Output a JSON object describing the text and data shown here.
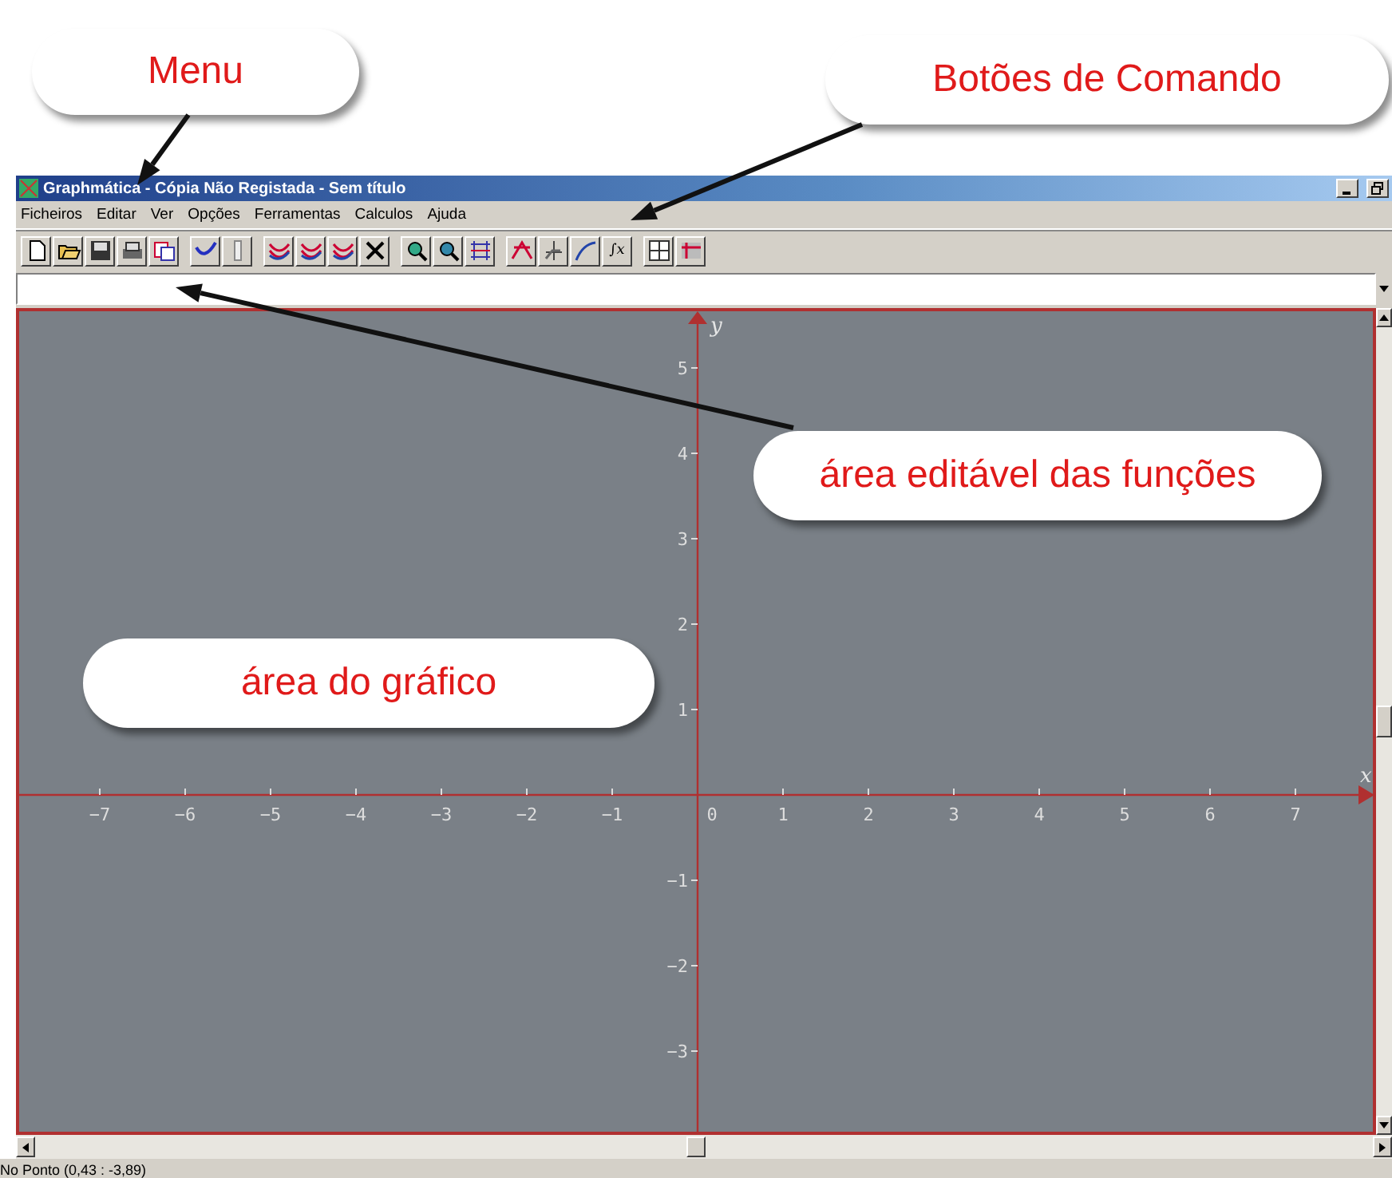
{
  "callouts": [
    {
      "text": "Menu"
    },
    {
      "text": "Botões de Comando"
    },
    {
      "text": "área editável das funções"
    },
    {
      "text": "área do gráfico"
    }
  ],
  "window": {
    "title": "Graphmática - Cópia Não Registada - Sem título"
  },
  "menu": [
    "Ficheiros",
    "Editar",
    "Ver",
    "Opções",
    "Ferramentas",
    "Calculos",
    "Ajuda"
  ],
  "toolbar": [
    [
      {
        "kind": "new"
      },
      {
        "kind": "open"
      },
      {
        "kind": "save"
      },
      {
        "kind": "print"
      },
      {
        "kind": "copy"
      }
    ],
    [
      {
        "kind": "pen"
      },
      {
        "kind": "ruler"
      }
    ],
    [
      {
        "kind": "curves"
      },
      {
        "kind": "curves"
      },
      {
        "kind": "curves"
      },
      {
        "kind": "delete"
      }
    ],
    [
      {
        "kind": "zoomin"
      },
      {
        "kind": "zoomout"
      },
      {
        "kind": "grid"
      }
    ],
    [
      {
        "kind": "tangent"
      },
      {
        "kind": "area"
      },
      {
        "kind": "curve"
      },
      {
        "kind": "text",
        "label": "∫x"
      }
    ],
    [
      {
        "kind": "table"
      },
      {
        "kind": "table2"
      }
    ]
  ],
  "graph": {
    "x_label": "x",
    "y_label": "y",
    "x_ticks_negative": [
      "−7",
      "−6",
      "−5",
      "−4",
      "−3",
      "−2",
      "−1"
    ],
    "origin": "0",
    "x_ticks_positive": [
      "1",
      "2",
      "3",
      "4",
      "5",
      "6",
      "7"
    ],
    "y_ticks_positive": [
      "5",
      "4",
      "3",
      "2",
      "1"
    ],
    "y_ticks_negative": [
      "−1",
      "−2",
      "−3"
    ]
  },
  "status_bar": "No Ponto (0,43 : -3,89)"
}
